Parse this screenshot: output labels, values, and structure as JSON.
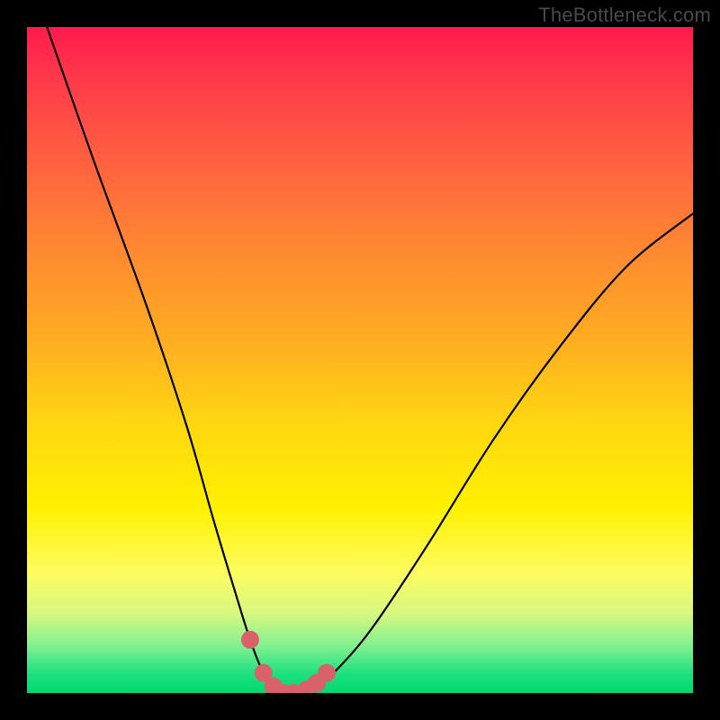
{
  "watermark": "TheBottleneck.com",
  "chart_data": {
    "type": "line",
    "title": "",
    "xlabel": "",
    "ylabel": "",
    "xlim": [
      0,
      100
    ],
    "ylim": [
      0,
      100
    ],
    "grid": false,
    "series": [
      {
        "name": "bottleneck-curve",
        "x": [
          3,
          10,
          18,
          24,
          28,
          31,
          33.5,
          35.5,
          37,
          38.5,
          40,
          42,
          44,
          47,
          52,
          60,
          70,
          80,
          90,
          100
        ],
        "y": [
          100,
          80,
          58,
          40,
          26,
          16,
          8,
          3,
          1,
          0,
          0,
          0.5,
          1.5,
          4,
          10,
          22,
          38,
          52,
          64,
          72
        ]
      }
    ],
    "markers": {
      "name": "highlight-dots",
      "color": "#d9626a",
      "points_x": [
        33.5,
        35.5,
        37,
        38.5,
        40,
        42,
        43.5,
        45
      ],
      "points_y": [
        8,
        3,
        1,
        0,
        0,
        0.5,
        1.5,
        3
      ]
    }
  }
}
